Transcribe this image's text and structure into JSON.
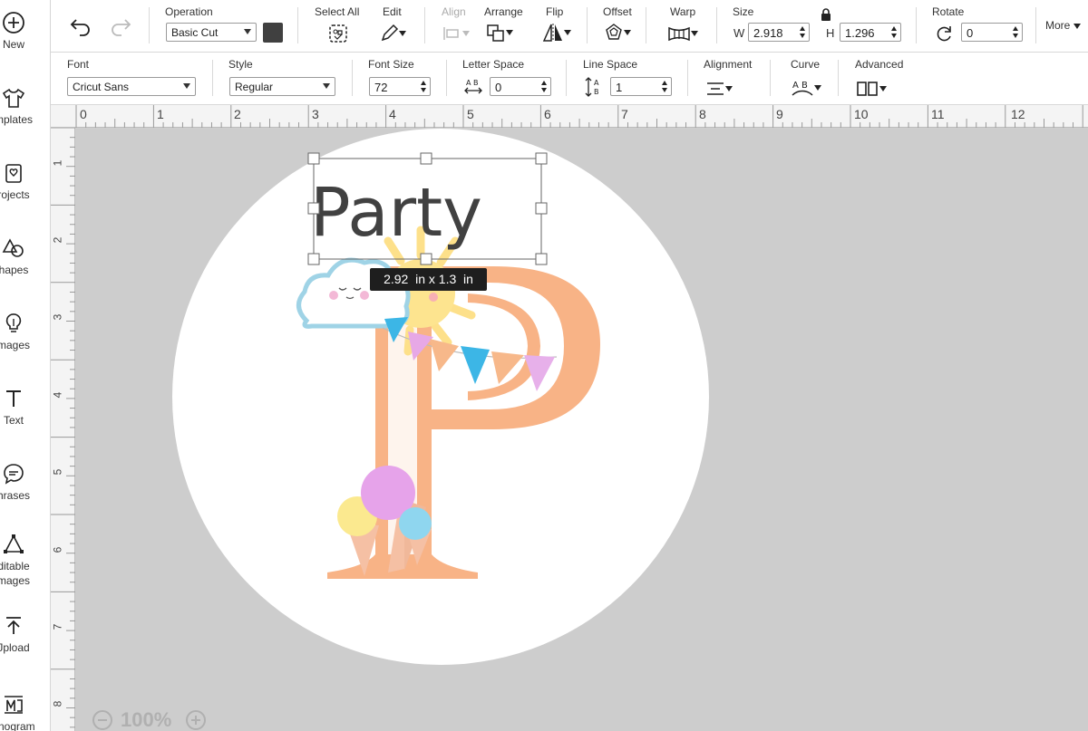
{
  "sidebar": {
    "items": [
      {
        "label": "New",
        "icon": "plus-circle-icon"
      },
      {
        "label": "mplates",
        "icon": "tshirt-icon"
      },
      {
        "label": "rojects",
        "icon": "projects-icon"
      },
      {
        "label": "hapes",
        "icon": "shapes-icon"
      },
      {
        "label": "mages",
        "icon": "lightbulb-icon"
      },
      {
        "label": "Text",
        "icon": "text-icon"
      },
      {
        "label": "hrases",
        "icon": "speech-bubble-icon"
      },
      {
        "label": "ditable\nmages",
        "icon": "editable-images-icon"
      },
      {
        "label": "Jpload",
        "icon": "upload-icon"
      },
      {
        "label": "onogram",
        "icon": "monogram-icon"
      }
    ]
  },
  "toolbar": {
    "operation_label": "Operation",
    "operation_value": "Basic Cut",
    "operation_color": "#404040",
    "select_all_label": "Select All",
    "edit_label": "Edit",
    "align_label": "Align",
    "arrange_label": "Arrange",
    "flip_label": "Flip",
    "offset_label": "Offset",
    "warp_label": "Warp",
    "size_label": "Size",
    "w_label": "W",
    "w_value": "2.918",
    "h_label": "H",
    "h_value": "1.296",
    "rotate_label": "Rotate",
    "rotate_value": "0",
    "more_label": "More"
  },
  "textbar": {
    "font_label": "Font",
    "font_value": "Cricut Sans",
    "style_label": "Style",
    "style_value": "Regular",
    "font_size_label": "Font Size",
    "font_size_value": "72",
    "letter_space_label": "Letter Space",
    "letter_space_value": "0",
    "line_space_label": "Line Space",
    "line_space_value": "1",
    "alignment_label": "Alignment",
    "curve_label": "Curve",
    "advanced_label": "Advanced"
  },
  "ruler": {
    "top": [
      "0",
      "1",
      "2",
      "3",
      "4",
      "5",
      "6",
      "7",
      "8",
      "9",
      "10",
      "11",
      "12"
    ],
    "left": [
      "1",
      "2",
      "3",
      "4",
      "5",
      "6",
      "7",
      "8"
    ]
  },
  "canvas": {
    "text_object": "Party",
    "size_tooltip": "2.92  in x 1.3  in",
    "zoom_value": "100%"
  }
}
